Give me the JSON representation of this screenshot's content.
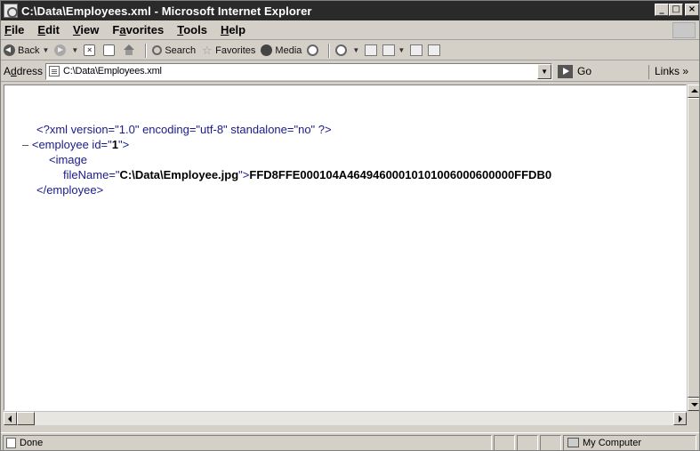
{
  "window": {
    "title": "C:\\Data\\Employees.xml - Microsoft Internet Explorer",
    "controls": {
      "minimize": "_",
      "maximize": "□",
      "close": "×"
    }
  },
  "menu": {
    "items": [
      {
        "label": "File",
        "accel": "F",
        "rest": "ile"
      },
      {
        "label": "Edit",
        "accel": "E",
        "rest": "dit"
      },
      {
        "label": "View",
        "accel": "V",
        "rest": "iew"
      },
      {
        "label": "Favorites",
        "pre": "F",
        "accel": "a",
        "rest": "vorites"
      },
      {
        "label": "Tools",
        "accel": "T",
        "rest": "ools"
      },
      {
        "label": "Help",
        "accel": "H",
        "rest": "elp"
      }
    ]
  },
  "toolbar": {
    "back_label": "Back",
    "search_label": "Search",
    "favorites_label": "Favorites",
    "media_label": "Media",
    "stop_glyph": "×"
  },
  "address": {
    "label_pre": "A",
    "label_accel": "d",
    "label_rest": "dress",
    "value": "C:\\Data\\Employees.xml",
    "go_label": "Go",
    "links_label": "Links »"
  },
  "xml": {
    "declaration": "<?xml version=\"1.0\" encoding=\"utf-8\" standalone=\"no\" ?>",
    "collapse_marker": "–",
    "employee_open_pre": "<employee id=\"",
    "employee_id": "1",
    "employee_open_post": "\">",
    "image_open": "<image",
    "filename_attr": "fileName=\"",
    "filename_value": "C:\\Data\\Employee.jpg",
    "filename_close": "\">",
    "image_data": "FFD8FFE000104A46494600010101006000600000FFDB0",
    "employee_close": "</employee>"
  },
  "status": {
    "text": "Done",
    "zone": "My Computer"
  }
}
